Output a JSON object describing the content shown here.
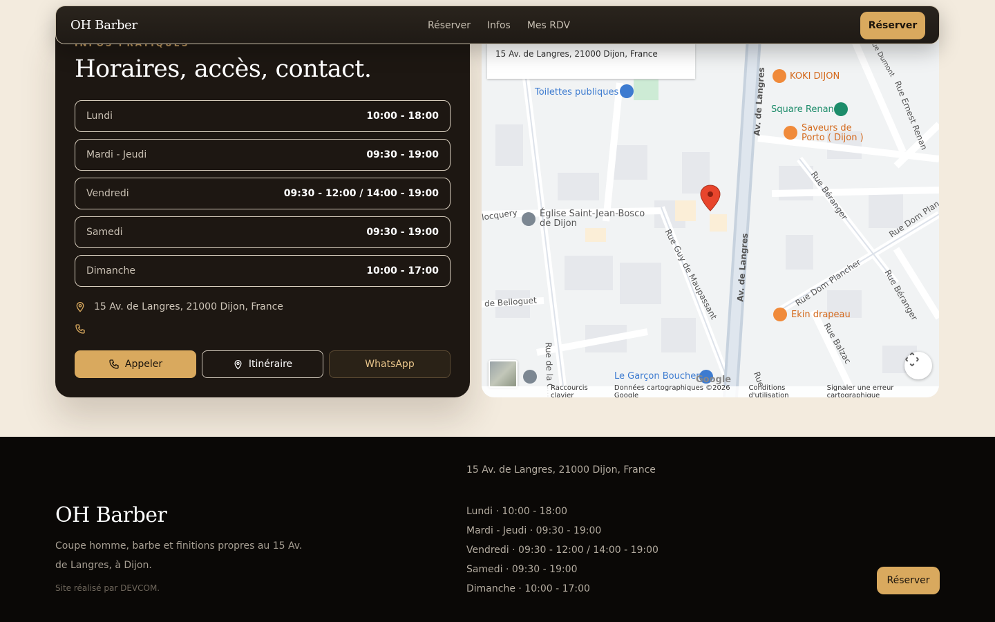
{
  "nav": {
    "brand": "OH Barber",
    "links": [
      "Réserver",
      "Infos",
      "Mes RDV"
    ],
    "cta": "Réserver"
  },
  "info": {
    "eyebrow": "INFOS PRATIQUES",
    "title": "Horaires, accès, contact.",
    "hours": [
      {
        "day": "Lundi",
        "time": "10:00 - 18:00"
      },
      {
        "day": "Mardi - Jeudi",
        "time": "09:30 - 19:00"
      },
      {
        "day": "Vendredi",
        "time": "09:30 - 12:00 / 14:00 - 19:00"
      },
      {
        "day": "Samedi",
        "time": "09:30 - 19:00"
      },
      {
        "day": "Dimanche",
        "time": "10:00 - 17:00"
      }
    ],
    "address": "15 Av. de Langres, 21000 Dijon, France",
    "buttons": {
      "call": "Appeler",
      "route": "Itinéraire",
      "whatsapp": "WhatsApp"
    }
  },
  "map": {
    "info_address": "15 Av. de Langres, 21000 Dijon, France",
    "labels": {
      "toilettes": "Toilettes publiques",
      "koki": "KOKI DIJON",
      "square": "Square Renan",
      "saveurs": "Saveurs de Porto ( Dijon )",
      "eglise": "Église Saint-Jean-Bosco de Dijon",
      "locquery": "locquery",
      "belloguet": "de Belloguet",
      "ekin": "Ekin drapeau",
      "garcon": "Le Garçon Boucher",
      "av_langres": "Av. de Langres",
      "guy": "Rue Guy de Maupassant",
      "beranger": "Rue Béranger",
      "dom_planchet": "Rue Dom Plancher",
      "dom_plan": "Rue Dom Plan",
      "ernest": "Rue Ernest Renan",
      "balzac": "Rue Balzac",
      "dumont": "Rue Dumont",
      "rue_la_c": "Rue de la C...",
      "rue": "Rue",
      "google": "Google"
    },
    "attribution": [
      "Raccourcis clavier",
      "Données cartographiques ©2026 Google",
      "Conditions d'utilisation",
      "Signaler une erreur cartographique"
    ]
  },
  "footer": {
    "brand": "OH Barber",
    "description": "Coupe homme, barbe et finitions propres au 15 Av. de Langres, à Dijon.",
    "credit": "Site réalisé par DEVCOM.",
    "address": "15 Av. de Langres, 21000 Dijon, France",
    "hours": [
      "Lundi · 10:00 - 18:00",
      "Mardi - Jeudi · 09:30 - 19:00",
      "Vendredi · 09:30 - 12:00 / 14:00 - 19:00",
      "Samedi · 09:30 - 19:00",
      "Dimanche · 10:00 - 17:00"
    ],
    "cta": "Réserver"
  },
  "colors": {
    "accent": "#d9a95e",
    "card": "#1d1712",
    "footer": "#0a0806",
    "page": "#f3ebde"
  }
}
